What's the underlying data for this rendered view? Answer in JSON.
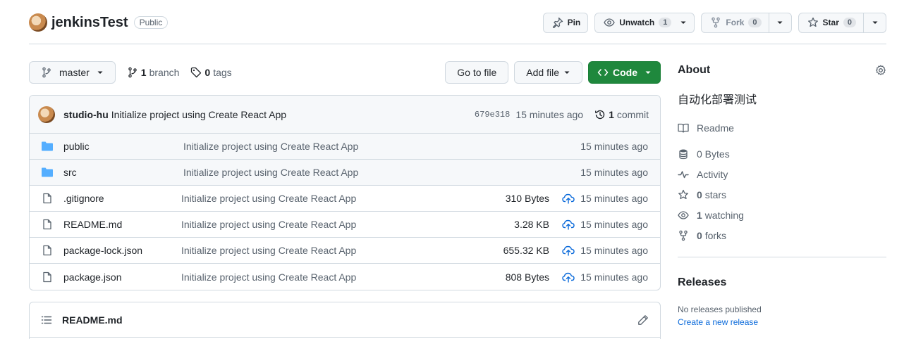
{
  "repo": {
    "name": "jenkinsTest",
    "visibility": "Public"
  },
  "header_actions": {
    "pin_label": "Pin",
    "unwatch_label": "Unwatch",
    "unwatch_count": "1",
    "fork_label": "Fork",
    "fork_count": "0",
    "star_label": "Star",
    "star_count": "0"
  },
  "toolbar": {
    "branch": "master",
    "branch_count": "1",
    "branch_word": "branch",
    "tag_count": "0",
    "tag_word": "tags",
    "go_to_file": "Go to file",
    "add_file": "Add file",
    "code": "Code"
  },
  "commit": {
    "author": "studio-hu",
    "message": "Initialize project using Create React App",
    "sha": "679e318",
    "age": "15 minutes ago",
    "count": "1",
    "count_word": "commit"
  },
  "files": [
    {
      "name": "public",
      "type": "dir",
      "message": "Initialize project using Create React App",
      "size": "",
      "age": "15 minutes ago"
    },
    {
      "name": "src",
      "type": "dir",
      "message": "Initialize project using Create React App",
      "size": "",
      "age": "15 minutes ago"
    },
    {
      "name": ".gitignore",
      "type": "file",
      "message": "Initialize project using Create React App",
      "size": "310 Bytes",
      "age": "15 minutes ago"
    },
    {
      "name": "README.md",
      "type": "file",
      "message": "Initialize project using Create React App",
      "size": "3.28 KB",
      "age": "15 minutes ago"
    },
    {
      "name": "package-lock.json",
      "type": "file",
      "message": "Initialize project using Create React App",
      "size": "655.32 KB",
      "age": "15 minutes ago"
    },
    {
      "name": "package.json",
      "type": "file",
      "message": "Initialize project using Create React App",
      "size": "808 Bytes",
      "age": "15 minutes ago"
    }
  ],
  "readme": {
    "title": "README.md"
  },
  "about": {
    "title": "About",
    "description": "自动化部署测试",
    "readme_label": "Readme",
    "size": "0 Bytes",
    "activity_label": "Activity",
    "stars_count": "0",
    "stars_word": "stars",
    "watching_count": "1",
    "watching_word": "watching",
    "forks_count": "0",
    "forks_word": "forks"
  },
  "releases": {
    "title": "Releases",
    "none_text": "No releases published",
    "create_link": "Create a new release"
  },
  "colors": {
    "accent_green": "#1f883d",
    "link_blue": "#0969da",
    "folder_blue": "#54aeff",
    "muted": "#59636e",
    "border": "#d1d9e0"
  }
}
